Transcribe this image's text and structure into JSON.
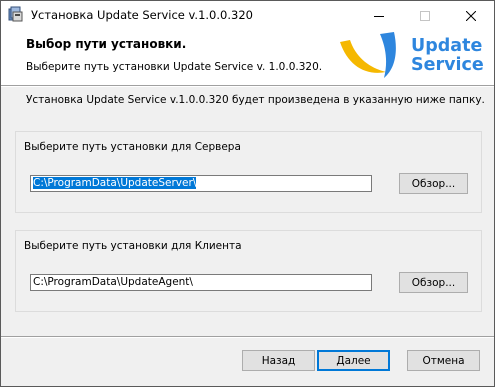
{
  "window": {
    "title": "Установка Update Service v.1.0.0.320"
  },
  "banner": {
    "title": "Выбор пути установки.",
    "subtitle": "Выберите путь установки Update Service v. 1.0.0.320.",
    "logo_line1": "Update",
    "logo_line2": "Service",
    "logo_colors": {
      "text": "#2e86de",
      "blue": "#2e86de",
      "yellow": "#f5b800"
    }
  },
  "intro": "Установка Update Service v.1.0.0.320 будет произведена в указанную ниже папку.",
  "server": {
    "label": "Выберите путь установки для Сервера",
    "path": "C:\\ProgramData\\UpdateServer\\",
    "browse_label": "Обзор..."
  },
  "client": {
    "label": "Выберите путь установки для Клиента",
    "path": "C:\\ProgramData\\UpdateAgent\\",
    "browse_label": "Обзор..."
  },
  "footer": {
    "back_label": "Назад",
    "next_label": "Далее",
    "cancel_label": "Отмена"
  }
}
